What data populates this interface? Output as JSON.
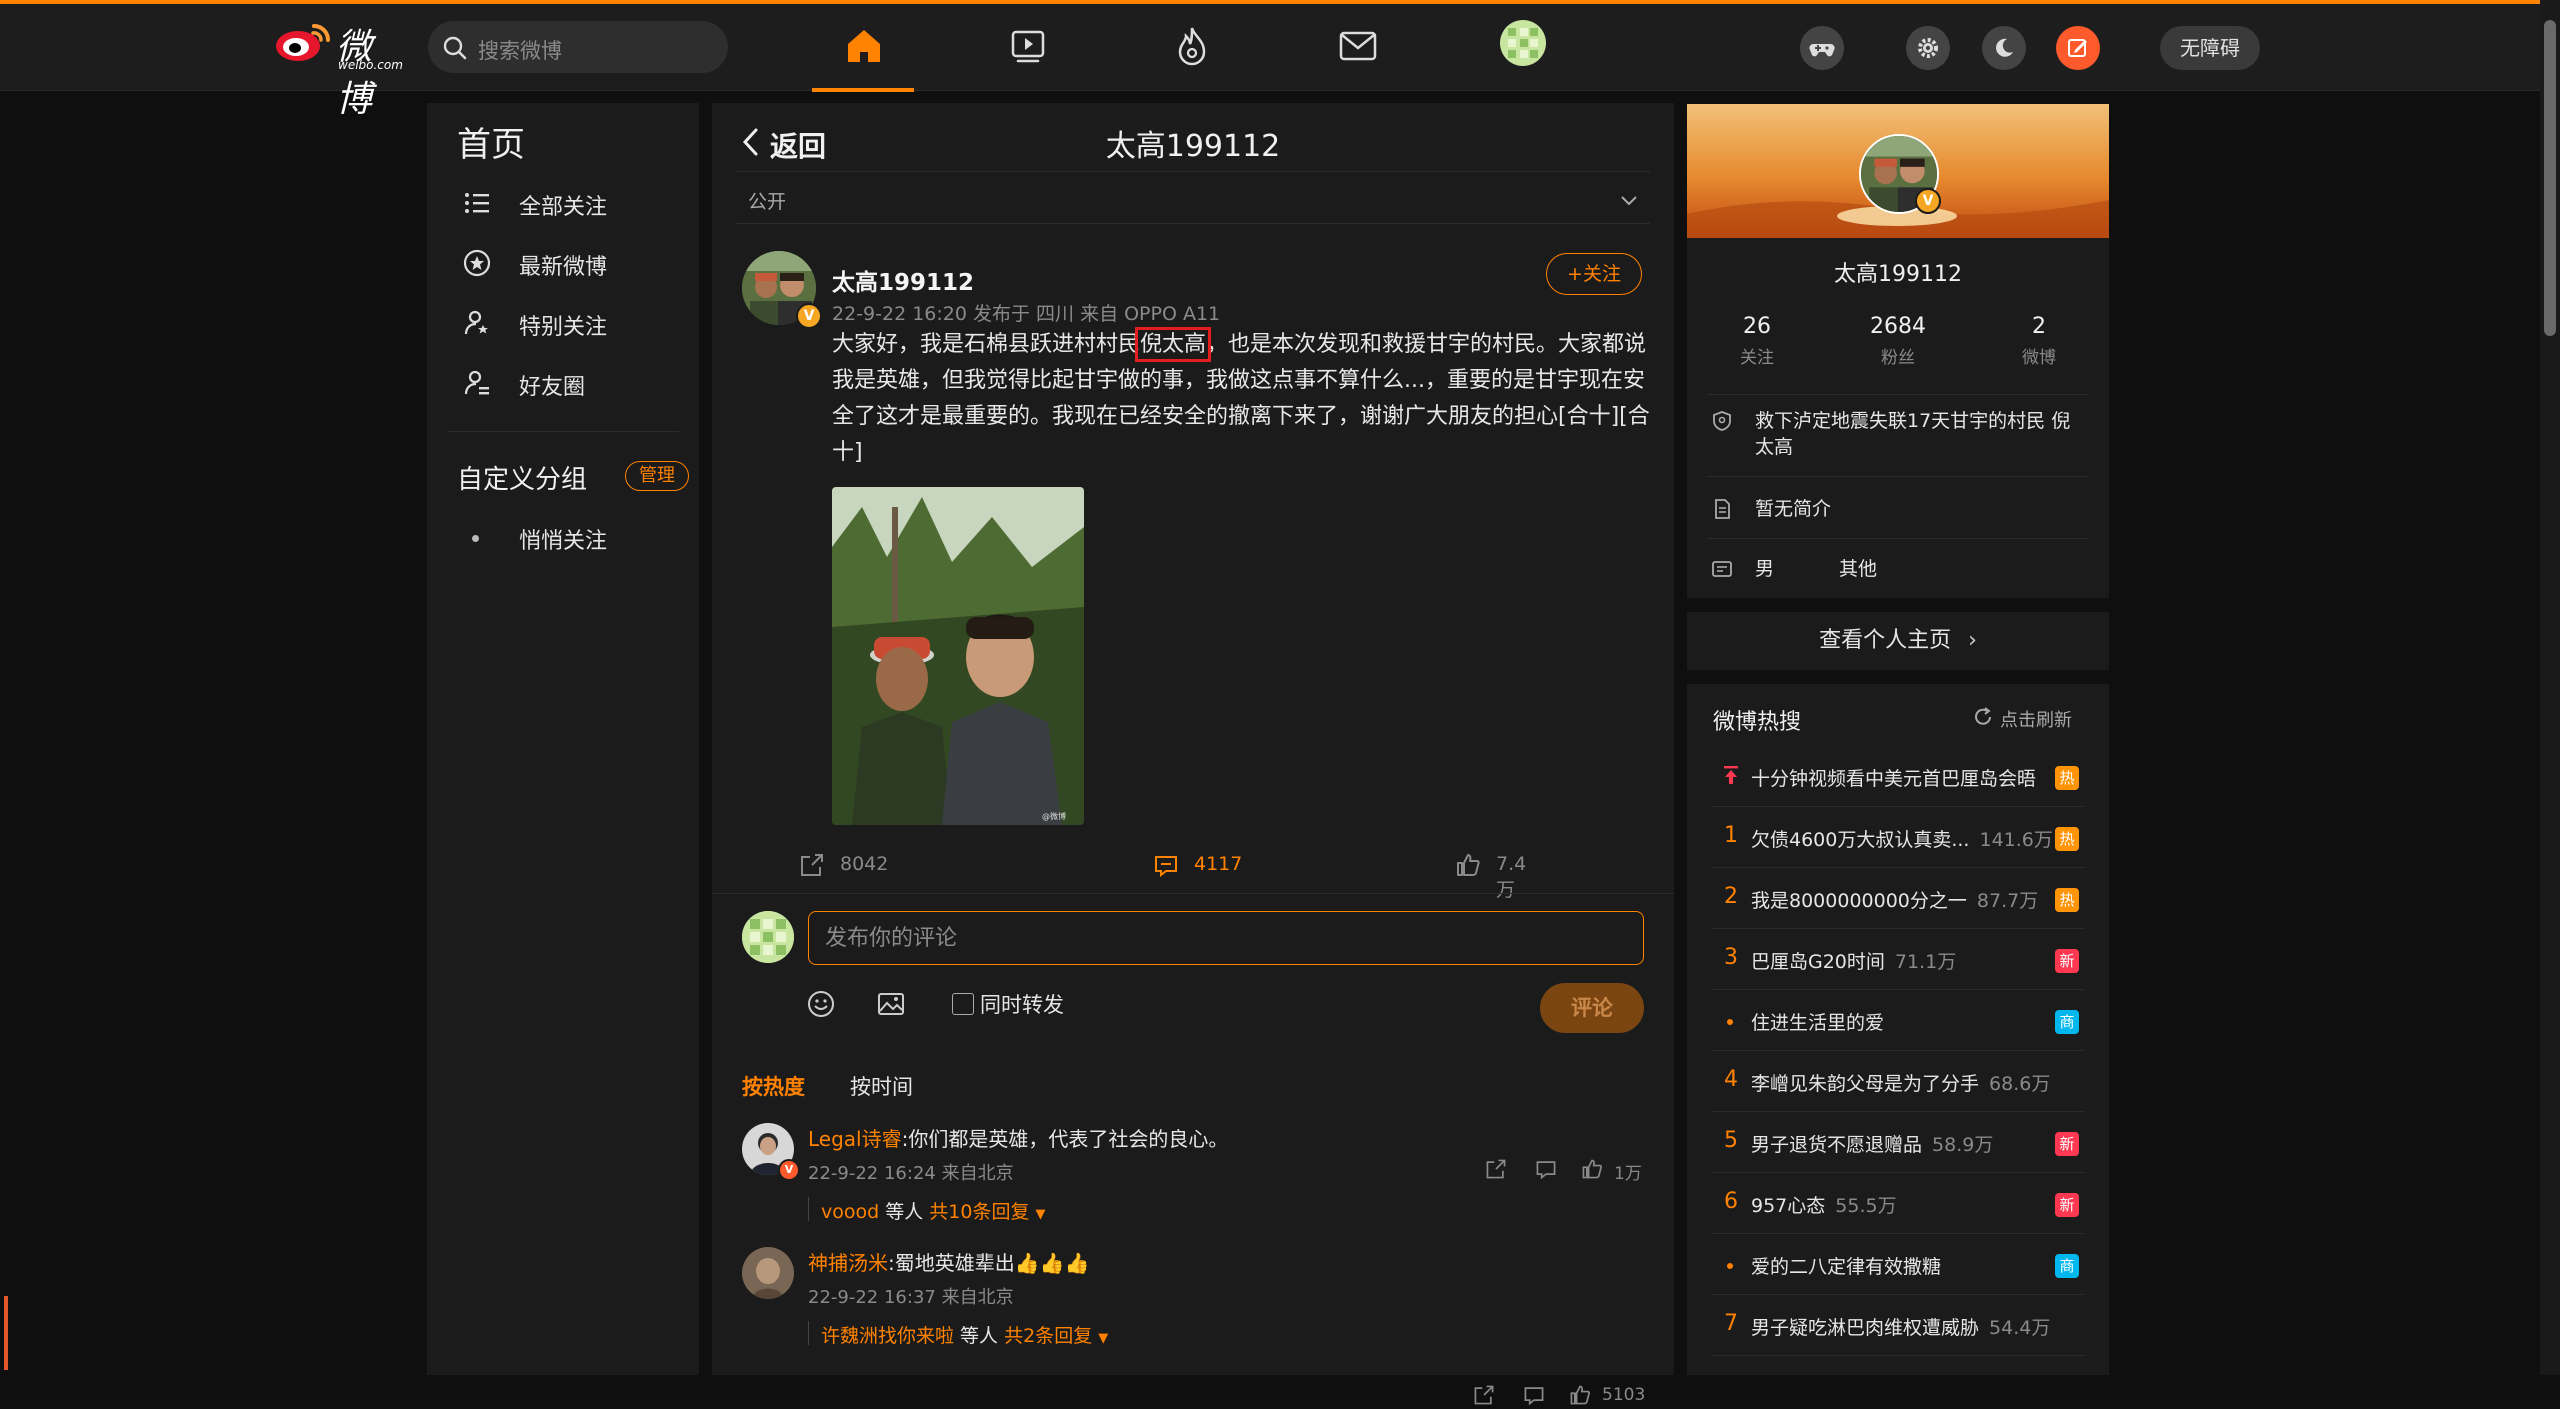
{
  "app": {
    "logo_text": "微博",
    "logo_sub": "weibo.com",
    "search_placeholder": "搜索微博",
    "accessibility_btn": "无障碍",
    "accent": "#ff8200"
  },
  "sidebar": {
    "title": "首页",
    "items": [
      {
        "label": "全部关注",
        "icon": "list-icon"
      },
      {
        "label": "最新微博",
        "icon": "star-circle-icon"
      },
      {
        "label": "特别关注",
        "icon": "user-star-icon"
      },
      {
        "label": "好友圈",
        "icon": "user-group-icon"
      }
    ],
    "custom_group": "自定义分组",
    "manage_label": "管理",
    "quiet_follow": "悄悄关注"
  },
  "post_view": {
    "back_label": "返回",
    "title": "太高199112",
    "visibility": "公开",
    "author": "太高199112",
    "meta": "22-9-22 16:20  发布于 四川  来自 OPPO A11",
    "follow_label": "+关注",
    "text_1": "大家好，我是石棉县跃进村村民",
    "text_highlight": "倪太高",
    "text_2": "，也是本次发现和救援甘宇的村民。大家都说我是英雄，但我觉得比起甘宇做的事，我做这点事不算什么...，重要的是甘宇现在安全了这才是最重要的。我现在已经安全的撤离下来了，谢谢广大朋友的担心[合十][合十]",
    "reposts": "8042",
    "comments": "4117",
    "likes": "7.4万"
  },
  "composer": {
    "placeholder": "发布你的评论",
    "repost_label": "同时转发",
    "submit_label": "评论"
  },
  "sort": {
    "hot": "按热度",
    "time": "按时间"
  },
  "comments": [
    {
      "user": "Legal诗睿",
      "text": ":你们都是英雄，代表了社会的良心。",
      "meta": "22-9-22 16:24 来自北京",
      "reply_user": "voood",
      "reply_mid": " 等人 ",
      "reply_count": "共10条回复",
      "likes": "1万"
    },
    {
      "user": "神捕汤米",
      "text": ":蜀地英雄辈出👍👍👍",
      "meta": "22-9-22 16:37 来自北京",
      "reply_user": "许魏洲找你来啦",
      "reply_mid": " 等人 ",
      "reply_count": "共2条回复",
      "likes": "5103"
    }
  ],
  "profile": {
    "name": "太高199112",
    "following": "26",
    "following_label": "关注",
    "followers": "2684",
    "followers_label": "粉丝",
    "posts": "2",
    "posts_label": "微博",
    "verified": "救下泸定地震失联17天甘宇的村民 倪太高",
    "bio": "暂无简介",
    "gender": "男",
    "other": "其他",
    "view_home": "查看个人主页"
  },
  "hot_search": {
    "title": "微博热搜",
    "refresh": "点击刷新",
    "items": [
      {
        "rank": "",
        "pinned": true,
        "text": "十分钟视频看中美元首巴厘岛会晤",
        "count": "",
        "badge": "热",
        "badge_color": "#ff9406"
      },
      {
        "rank": "1",
        "text": "欠债4600万大叔认真卖...",
        "count": "141.6万",
        "badge": "热",
        "badge_color": "#ff9406"
      },
      {
        "rank": "2",
        "text": "我是8000000000分之一",
        "count": "87.7万",
        "badge": "热",
        "badge_color": "#ff9406"
      },
      {
        "rank": "3",
        "text": "巴厘岛G20时间",
        "count": "71.1万",
        "badge": "新",
        "badge_color": "#ff3852"
      },
      {
        "rank": "•",
        "text": "住进生活里的爱",
        "count": "",
        "badge": "商",
        "badge_color": "#00b7ee"
      },
      {
        "rank": "4",
        "text": "李嶒见朱韵父母是为了分手",
        "count": "68.6万",
        "badge": "",
        "badge_color": ""
      },
      {
        "rank": "5",
        "text": "男子退货不愿退赠品",
        "count": "58.9万",
        "badge": "新",
        "badge_color": "#ff3852"
      },
      {
        "rank": "6",
        "text": "957心态",
        "count": "55.5万",
        "badge": "新",
        "badge_color": "#ff3852"
      },
      {
        "rank": "•",
        "text": "爱的二八定律有效撒糖",
        "count": "",
        "badge": "商",
        "badge_color": "#00b7ee"
      },
      {
        "rank": "7",
        "text": "男子疑吃淋巴肉维权遭威胁",
        "count": "54.4万",
        "badge": "",
        "badge_color": ""
      }
    ]
  }
}
